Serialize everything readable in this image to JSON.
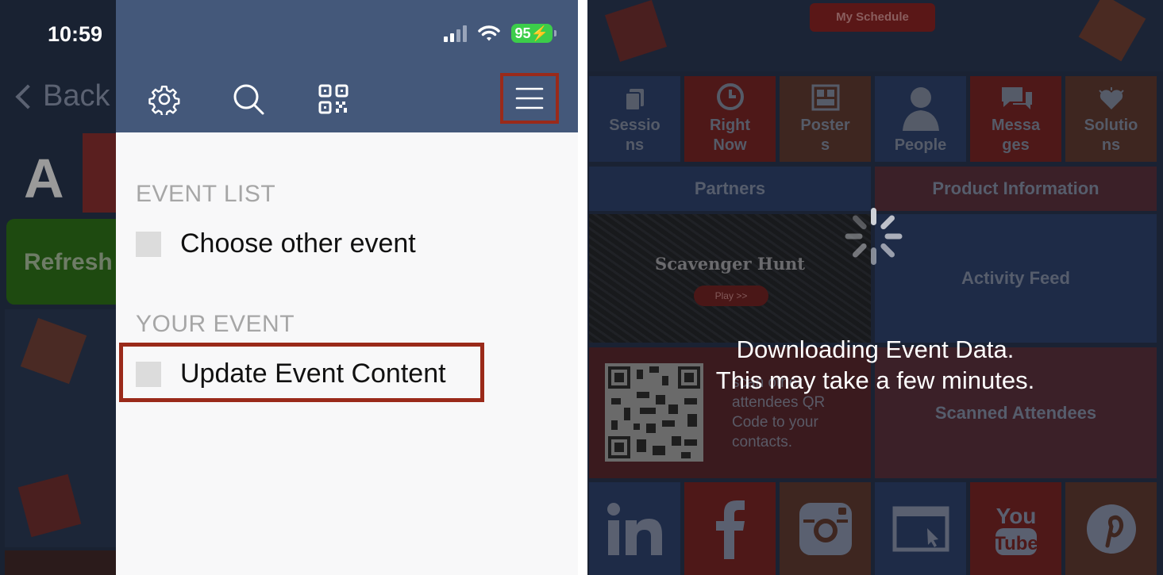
{
  "left_phone": {
    "status_time": "10:59",
    "battery_level": "95",
    "background": {
      "back_label": "Back",
      "letter_a": "A",
      "refresh_label": "Refresh"
    },
    "toolbar": {
      "icons": [
        "gear-icon",
        "search-icon",
        "qr-code-icon",
        "hamburger-menu-icon"
      ]
    },
    "menu": {
      "event_list_header": "EVENT LIST",
      "choose_event": "Choose other event",
      "your_event_header": "YOUR EVENT",
      "update_content": "Update Event Content"
    },
    "colors": {
      "header_bg": "#44587a",
      "highlight": "#9a2a1a",
      "panel_bg": "#f8f8f9"
    }
  },
  "right_phone": {
    "my_schedule": "My Schedule",
    "tiles": [
      {
        "label": "Sessio\nns",
        "icon": "document-icon"
      },
      {
        "label": "Right\nNow",
        "icon": "clock-icon"
      },
      {
        "label": "Poster\ns",
        "icon": "poster-icon"
      },
      {
        "label": "People",
        "icon": "person-icon"
      },
      {
        "label": "Messa\nges",
        "icon": "chat-icon"
      },
      {
        "label": "Solutio\nns",
        "icon": "heart-icon"
      }
    ],
    "partners": "Partners",
    "product_information": "Product Information",
    "scavenger_hunt": "Scavenger Hunt",
    "play": "Play >>",
    "activity_feed": "Activity Feed",
    "qr_text": "scan other attendees QR Code to your contacts.",
    "scanned_attendees": "Scanned Attendees",
    "social": [
      "linkedin-icon",
      "facebook-icon",
      "instagram-icon",
      "website-icon",
      "youtube-icon",
      "pinterest-icon"
    ],
    "loading_line1": "Downloading Event Data.",
    "loading_line2": "This may take a few minutes."
  }
}
